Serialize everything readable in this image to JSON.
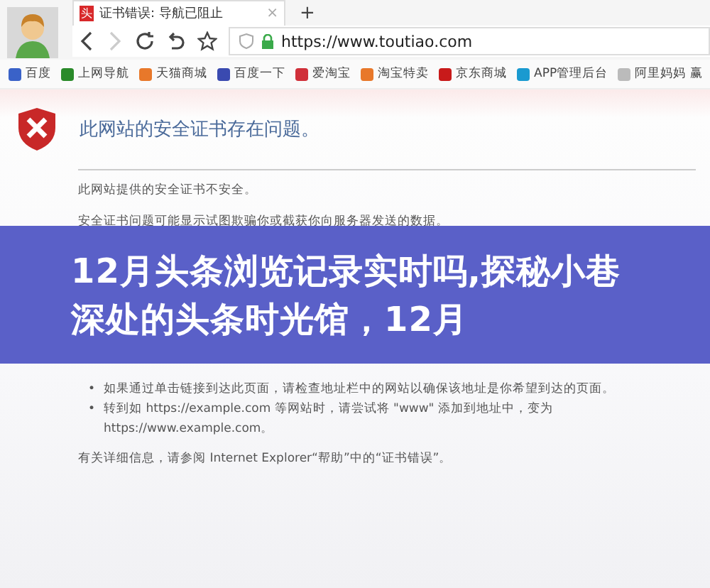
{
  "tab": {
    "icon": "头",
    "title": "证书错误: 导航已阻止",
    "close": "×"
  },
  "new_tab": "+",
  "address": {
    "url": "https://www.toutiao.com"
  },
  "bookmarks": [
    {
      "label": "百度"
    },
    {
      "label": "上网导航"
    },
    {
      "label": "天猫商城"
    },
    {
      "label": "百度一下"
    },
    {
      "label": "爱淘宝"
    },
    {
      "label": "淘宝特卖"
    },
    {
      "label": "京东商城"
    },
    {
      "label": "APP管理后台"
    },
    {
      "label": "阿里妈妈 赢"
    }
  ],
  "page": {
    "heading": "此网站的安全证书存在问题。",
    "lines": [
      "此网站提供的安全证书不安全。",
      "安全证书问题可能显示试图欺骗你或截获你向服务器发送的数据。"
    ],
    "bullets": [
      {
        "marker": "•",
        "text": "如果通过单击链接到达此页面，请检查地址栏中的网站以确保该地址是你希望到达的页面。"
      },
      {
        "marker": "•",
        "text": "转到如 https://example.com 等网站时，请尝试将 \"www\" 添加到地址中，变为 https://www.example.com。"
      }
    ],
    "more_info": "有关详细信息，请参阅 Internet Explorer“帮助”中的“证书错误”。"
  },
  "banner": {
    "title": "12月头条浏览记录实时吗,探秘小巷深处的头条时光馆，12月"
  }
}
